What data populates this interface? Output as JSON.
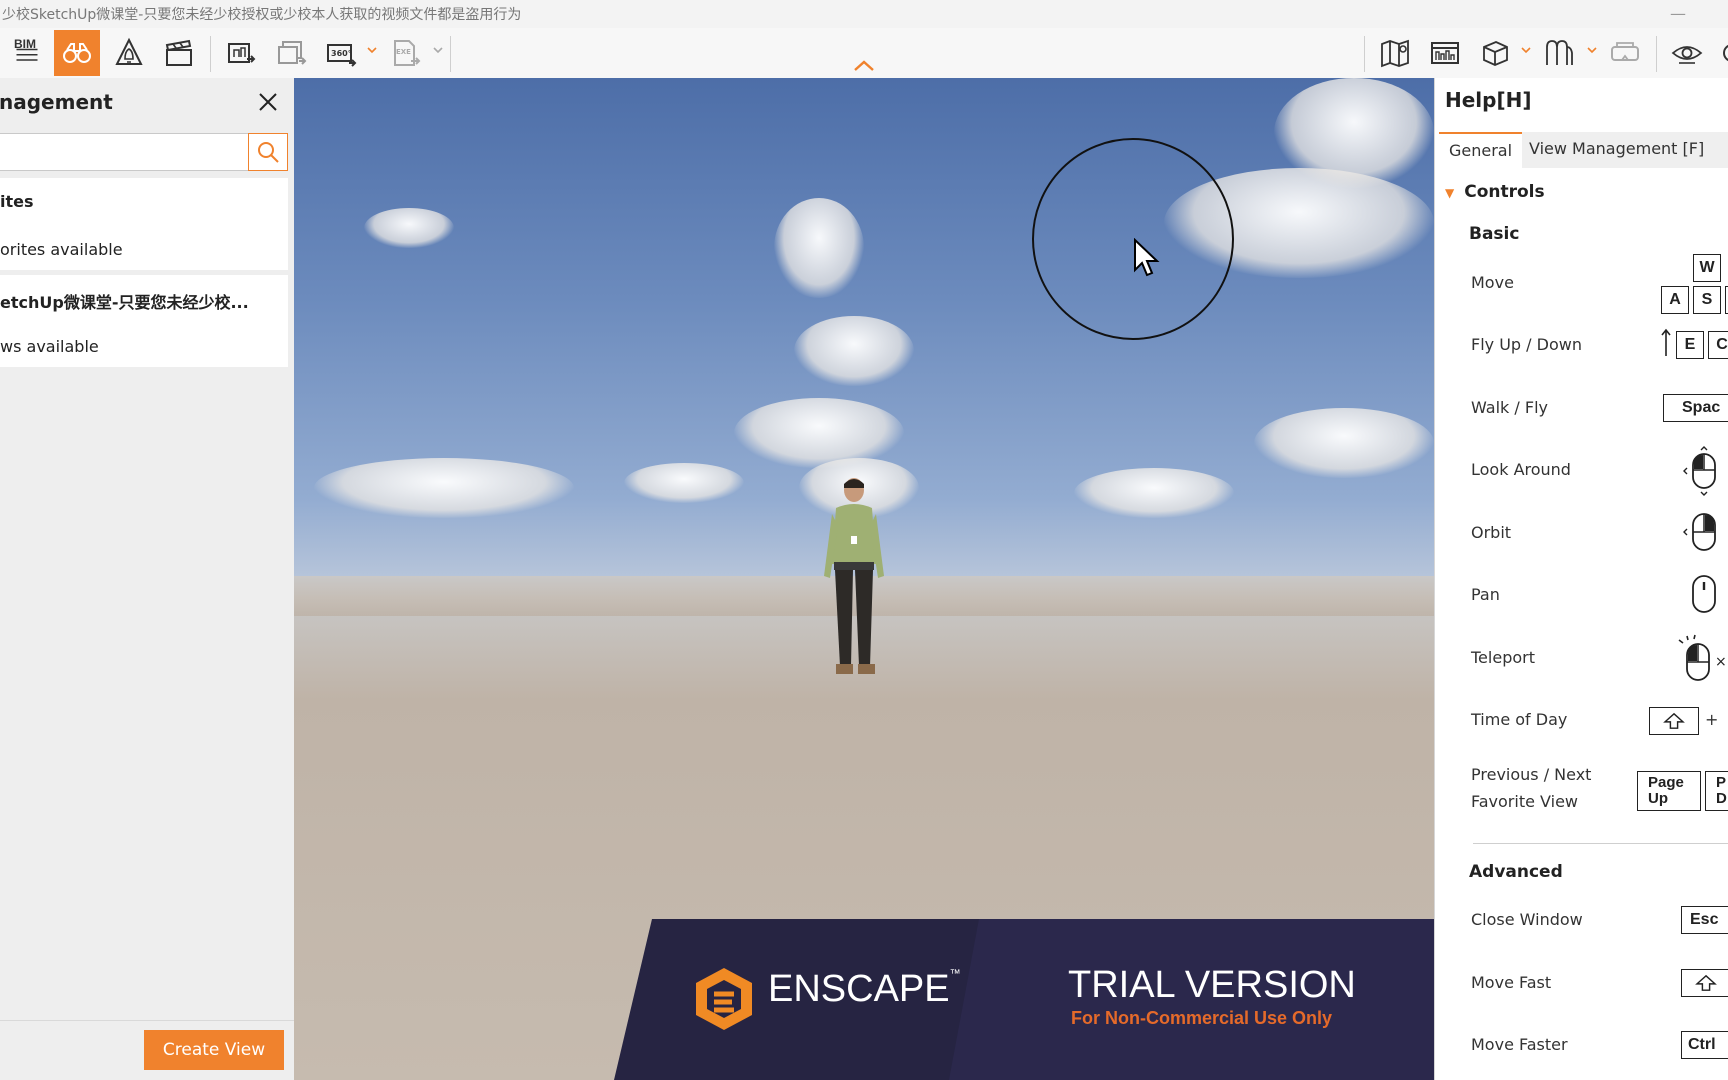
{
  "window": {
    "title": "少校SketchUp微课堂-只要您未经少校授权或少校本人获取的视频文件都是盗用行为",
    "minimize_glyph": "—"
  },
  "toolbar": {
    "bim_label": "BIM",
    "buttons": [
      {
        "name": "bim-menu",
        "icon": "hamburger-icon"
      },
      {
        "name": "views",
        "icon": "binoculars-icon",
        "active": true
      },
      {
        "name": "atmosphere",
        "icon": "bell-triangle-icon"
      },
      {
        "name": "video",
        "icon": "clapperboard-icon"
      },
      {
        "name": "screenshot",
        "icon": "screenshot-icon"
      },
      {
        "name": "batch-render",
        "icon": "batch-render-icon"
      },
      {
        "name": "panorama",
        "icon": "panorama-360-icon",
        "label": "360°"
      },
      {
        "name": "export-exe",
        "icon": "export-exe-icon",
        "label": "EXE"
      },
      {
        "name": "map",
        "icon": "map-icon"
      },
      {
        "name": "asset-library",
        "icon": "asset-library-icon"
      },
      {
        "name": "cube",
        "icon": "cube-icon"
      },
      {
        "name": "material",
        "icon": "material-icon"
      },
      {
        "name": "vr",
        "icon": "vr-headset-icon"
      },
      {
        "name": "eye",
        "icon": "eye-icon"
      },
      {
        "name": "settings",
        "icon": "gear-icon"
      }
    ],
    "accent_color": "#f0822d"
  },
  "left_panel": {
    "title": "nagement",
    "search": {
      "value": "",
      "placeholder": ""
    },
    "favorites_title": "ites",
    "favorites_empty": "orites available",
    "model_title": "etchUp微课堂-只要您未经少校...",
    "views_empty": "ws available",
    "create_button": "Create View"
  },
  "viewport": {
    "banner_brand": "ENSCAPE",
    "banner_tm": "™",
    "trial_title": "TRIAL VERSION",
    "trial_subtitle": "For Non-Commercial Use Only"
  },
  "help": {
    "title": "Help[H]",
    "tabs": [
      "General",
      "View Management [F]"
    ],
    "active_tab": 0,
    "section": "Controls",
    "basic_heading": "Basic",
    "advanced_heading": "Advanced",
    "basic": [
      {
        "label": "Move",
        "keys": [
          "W",
          "A",
          "S"
        ]
      },
      {
        "label": "Fly Up / Down",
        "keys": [
          "E",
          "C"
        ]
      },
      {
        "label": "Walk / Fly",
        "keys": [
          "Space"
        ]
      },
      {
        "label": "Look Around",
        "keys": []
      },
      {
        "label": "Orbit",
        "keys": []
      },
      {
        "label": "Pan",
        "keys": []
      },
      {
        "label": "Teleport",
        "keys": []
      },
      {
        "label": "Time of Day",
        "keys": [
          "+"
        ]
      },
      {
        "label": "Previous / Next\nFavorite View",
        "label_line1": "Previous / Next",
        "label_line2": "Favorite View",
        "keys": [
          "Page Up",
          "Page Down"
        ]
      }
    ],
    "advanced": [
      {
        "label": "Close Window",
        "keys": [
          "Esc"
        ]
      },
      {
        "label": "Move Fast",
        "keys": []
      },
      {
        "label": "Move Faster",
        "keys": [
          "Ctrl"
        ]
      }
    ],
    "key_labels": {
      "w": "W",
      "a": "A",
      "s": "S",
      "e": "E",
      "c": "C",
      "space": "Spac",
      "page_up_1": "Page",
      "page_up_2": "Up",
      "page_down_1": "P",
      "page_down_2": "D",
      "esc": "Esc",
      "ctrl": "Ctrl",
      "plus": "+",
      "times": "×"
    }
  }
}
